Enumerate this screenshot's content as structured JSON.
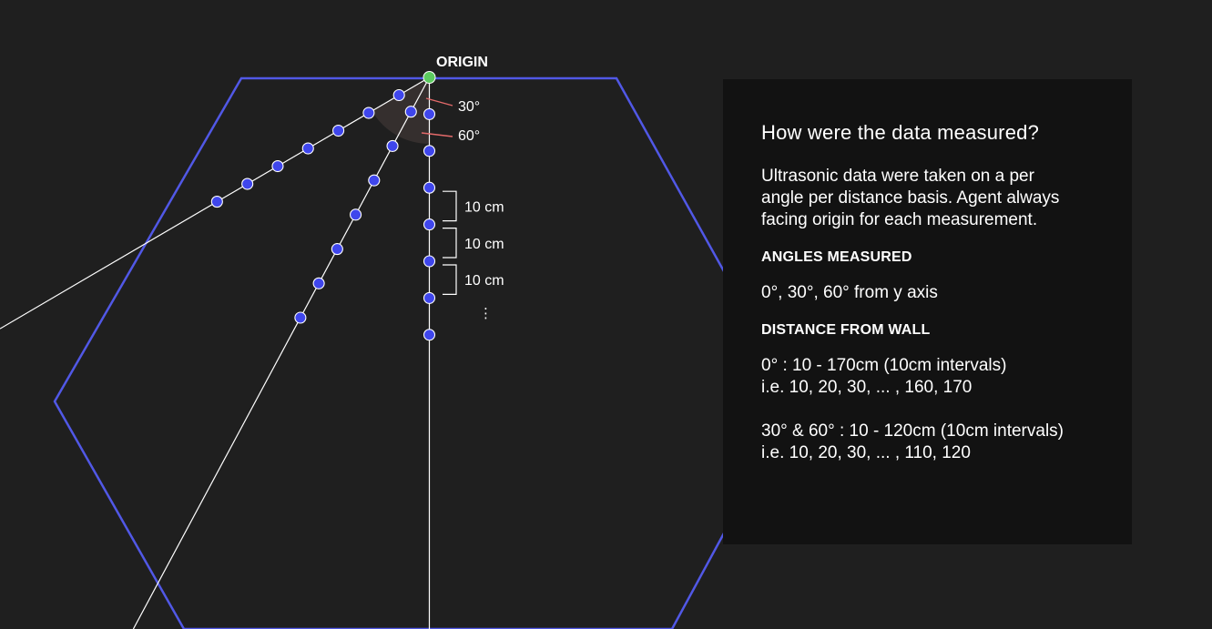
{
  "diagram": {
    "origin_label": "ORIGIN",
    "angle_labels": [
      "30°",
      "60°"
    ],
    "interval_label": "10 cm",
    "interval_count": 3,
    "ellipsis": "⋮",
    "colors": {
      "background": "#1f1f1f",
      "hexagon": "#5158e6",
      "ray": "#ffffff",
      "point_fill": "#3f46ec",
      "point_stroke": "#ffffff",
      "origin_fill": "#5ccb5f",
      "angle_marker": "#e46a6a",
      "angle_wedge": "#3a3331",
      "label": "#ffffff"
    }
  },
  "panel": {
    "title": "How were the data measured?",
    "intro_lines": [
      "Ultrasonic data were taken on a per",
      "angle per distance basis. Agent always",
      "facing origin for each measurement."
    ],
    "angles_heading": "ANGLES MEASURED",
    "angles_value": "0°, 30°, 60° from y axis",
    "distance_heading": "DISTANCE FROM WALL",
    "distance_0": {
      "range": "0° : 10 - 170cm (10cm intervals)",
      "example": "i.e. 10, 20, 30, ... , 160, 170"
    },
    "distance_30_60": {
      "range": "30° & 60° : 10 - 120cm (10cm intervals)",
      "example": "i.e. 10, 20, 30, ... , 110, 120"
    }
  }
}
